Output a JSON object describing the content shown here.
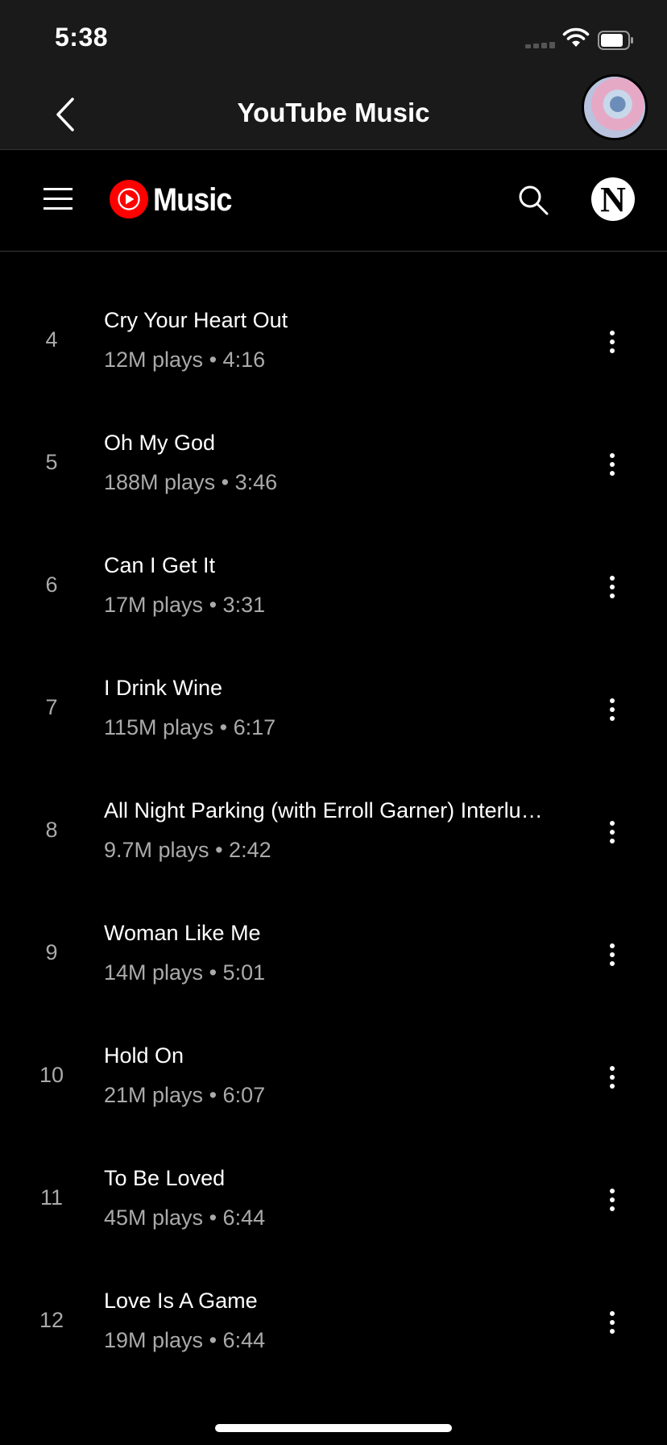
{
  "status": {
    "time": "5:38"
  },
  "browser": {
    "title": "YouTube Music"
  },
  "app": {
    "logo_text": "Music",
    "account_initial": "N"
  },
  "tracks": [
    {
      "num": "4",
      "title": "Cry Your Heart Out",
      "plays": "12M plays",
      "duration": "4:16"
    },
    {
      "num": "5",
      "title": "Oh My God",
      "plays": "188M plays",
      "duration": "3:46"
    },
    {
      "num": "6",
      "title": "Can I Get It",
      "plays": "17M plays",
      "duration": "3:31"
    },
    {
      "num": "7",
      "title": "I Drink Wine",
      "plays": "115M plays",
      "duration": "6:17"
    },
    {
      "num": "8",
      "title": "All Night Parking (with Erroll Garner) Interlu…",
      "plays": "9.7M plays",
      "duration": "2:42"
    },
    {
      "num": "9",
      "title": "Woman Like Me",
      "plays": "14M plays",
      "duration": "5:01"
    },
    {
      "num": "10",
      "title": "Hold On",
      "plays": "21M plays",
      "duration": "6:07"
    },
    {
      "num": "11",
      "title": "To Be Loved",
      "plays": "45M plays",
      "duration": "6:44"
    },
    {
      "num": "12",
      "title": "Love Is A Game",
      "plays": "19M plays",
      "duration": "6:44"
    }
  ],
  "separator": "•",
  "colors": {
    "brand_red": "#ff0000",
    "background": "#000000",
    "secondary_text": "#aaaaaa"
  },
  "icons": [
    "back-chevron-icon",
    "hamburger-menu-icon",
    "youtube-music-logo-icon",
    "search-icon",
    "more-vertical-icon",
    "wifi-icon",
    "battery-icon",
    "signal-icon"
  ]
}
